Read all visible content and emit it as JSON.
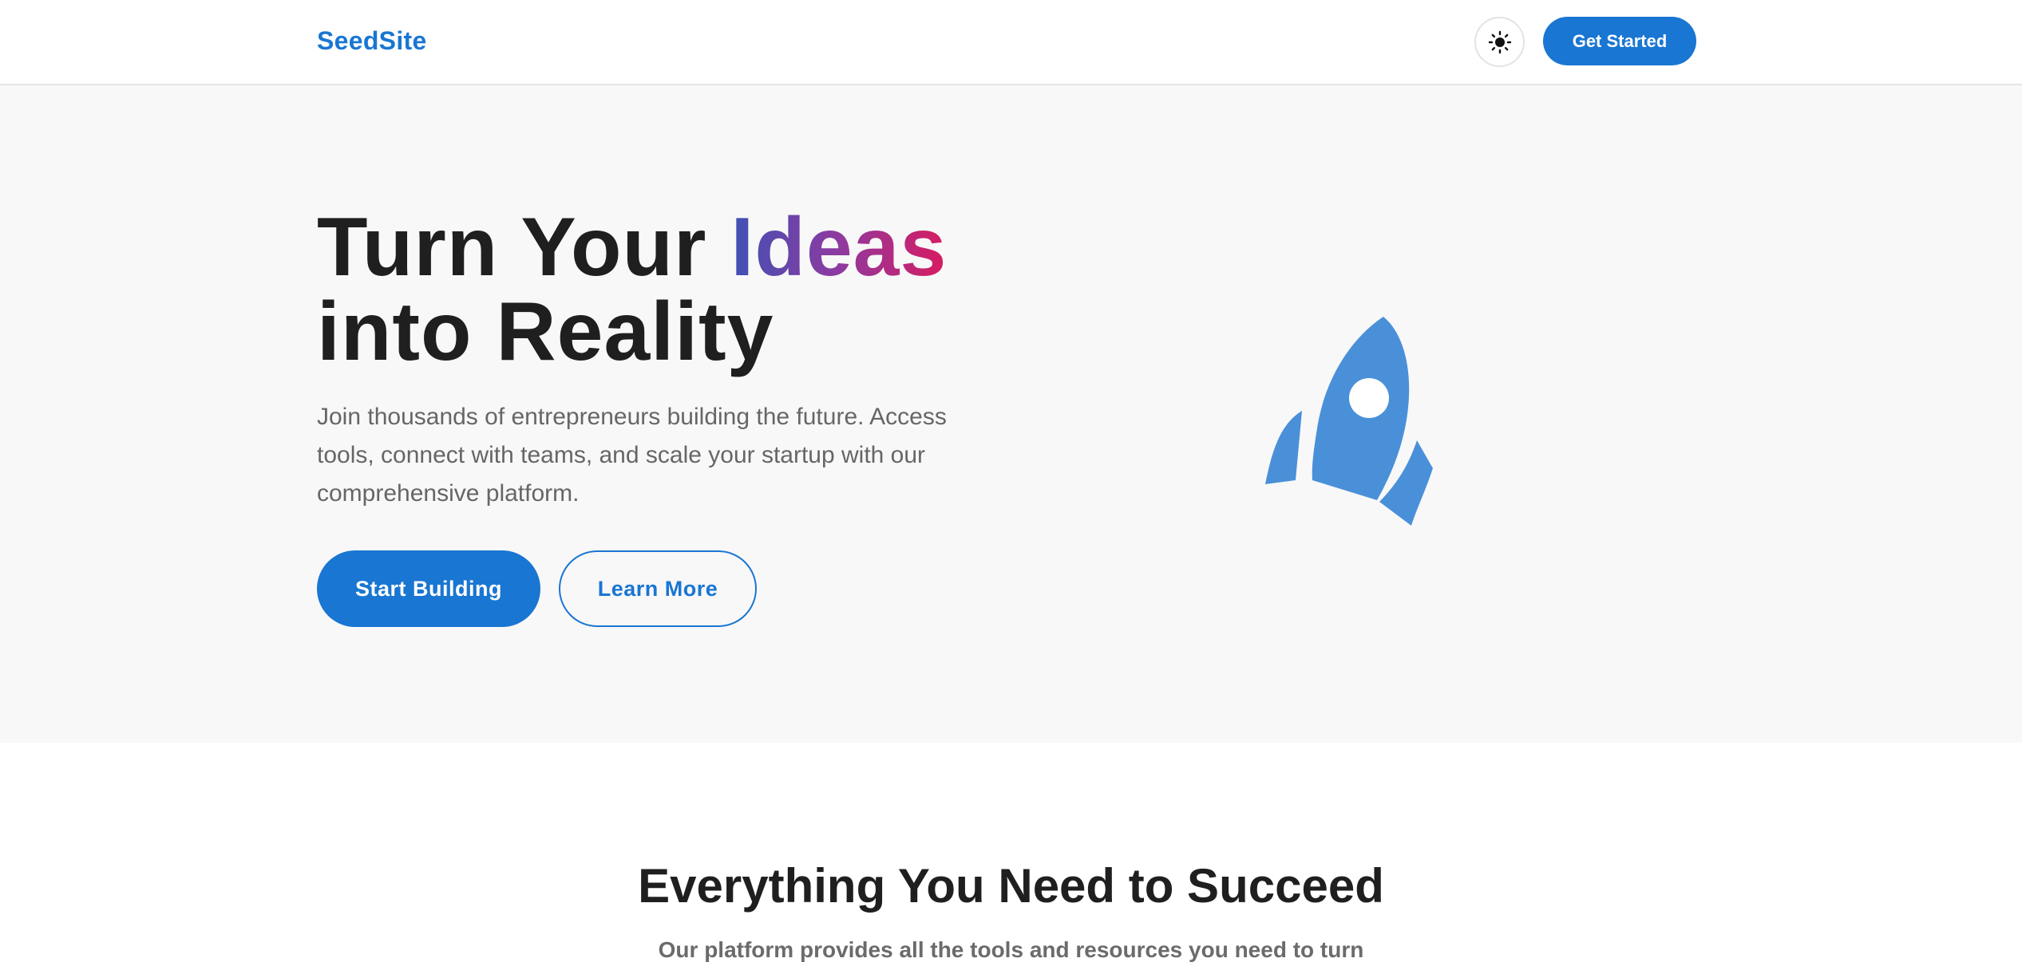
{
  "header": {
    "logo": "SeedSite",
    "theme_toggle_icon": "sun-icon",
    "cta_label": "Get Started"
  },
  "hero": {
    "title_part1": "Turn Your ",
    "title_highlight": "Ideas",
    "title_part2": "into Reality",
    "description": "Join thousands of entrepreneurs building the future. Access tools, connect with teams, and scale your startup with our comprehensive platform.",
    "primary_button": "Start Building",
    "secondary_button": "Learn More",
    "illustration_icon": "rocket-icon"
  },
  "features": {
    "title": "Everything You Need to Succeed",
    "subtitle": "Our platform provides all the tools and resources you need to turn"
  },
  "colors": {
    "brand": "#1976d2",
    "hero_bg": "#f8f8f8",
    "rocket": "#4a90d9",
    "gradient_start": "#3f51b5",
    "gradient_end": "#d81b60"
  }
}
